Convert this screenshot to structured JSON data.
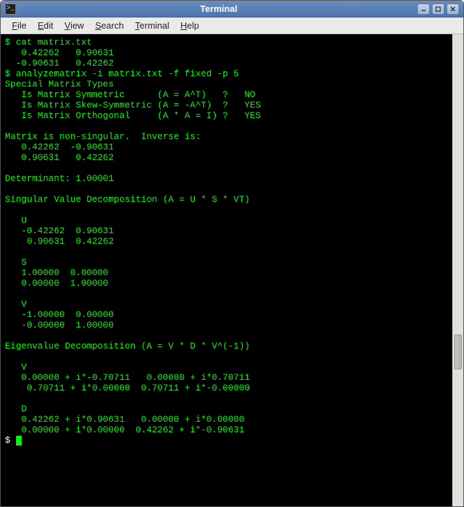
{
  "window": {
    "title": "Terminal"
  },
  "menu": {
    "file": "File",
    "edit": "Edit",
    "view": "View",
    "search": "Search",
    "terminal": "Terminal",
    "help": "Help"
  },
  "terminal": {
    "l01": "$ cat matrix.txt",
    "l02": "   0.42262   0.90631",
    "l03": "  -0.90631   0.42262",
    "l04": "$ analyzematrix -i matrix.txt -f fixed -p 5",
    "l05": "Special Matrix Types",
    "l06": "   Is Matrix Symmetric      (A = A^T)   ?   NO",
    "l07": "   Is Matrix Skew-Symmetric (A = -A^T)  ?   YES",
    "l08": "   Is Matrix Orthogonal     (A * A = I) ?   YES",
    "l09": "",
    "l10": "Matrix is non-singular.  Inverse is:",
    "l11": "   0.42262  -0.90631",
    "l12": "   0.90631   0.42262",
    "l13": "",
    "l14": "Determinant: 1.00001",
    "l15": "",
    "l16": "Singular Value Decomposition (A = U * S * VT)",
    "l17": "",
    "l18": "   U",
    "l19": "   -0.42262  0.90631",
    "l20": "    0.90631  0.42262",
    "l21": "",
    "l22": "   S",
    "l23": "   1.00000  0.00000",
    "l24": "   0.00000  1.00000",
    "l25": "",
    "l26": "   V",
    "l27": "   -1.00000  0.00000",
    "l28": "   -0.00000  1.00000",
    "l29": "",
    "l30": "Eigenvalue Decomposition (A = V * D * V^(-1))",
    "l31": "",
    "l32": "   V",
    "l33": "   0.00000 + i*-0.70711   0.00000 + i*0.70711",
    "l34": "    0.70711 + i*0.00000  0.70711 + i*-0.00000",
    "l35": "",
    "l36": "   D",
    "l37": "   0.42262 + i*0.90631   0.00000 + i*0.00000",
    "l38": "   0.00000 + i*0.00000  0.42262 + i*-0.90631",
    "l39": "$ "
  }
}
